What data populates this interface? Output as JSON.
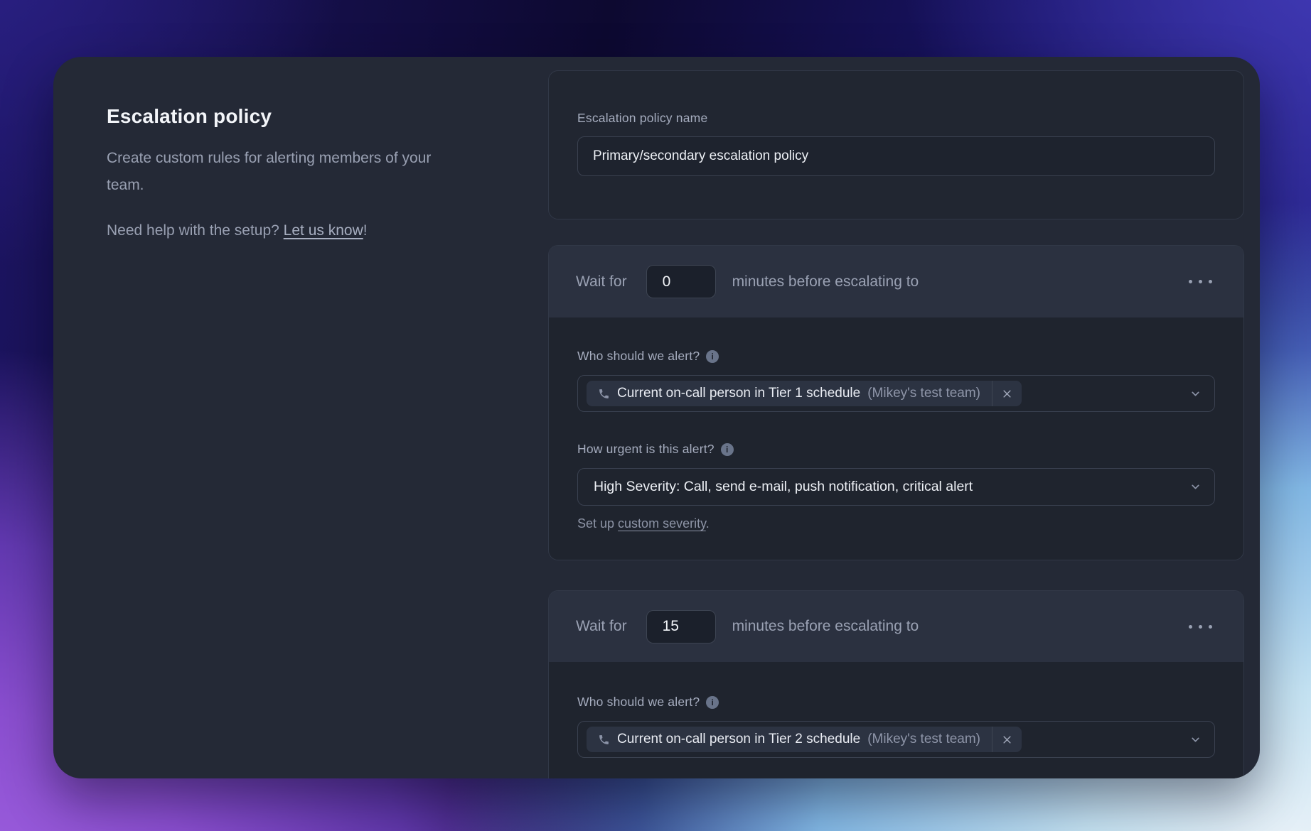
{
  "colors": {
    "card_bg": "#242936",
    "panel_body_bg": "#1f242e",
    "panel_header_bg": "#2b3140",
    "chip_bg": "#2c3342",
    "border": "#3a4150",
    "text_primary": "#f3f5f9",
    "text_muted": "#99a0b2",
    "gradient_top_left": "#2b2187",
    "gradient_top_center": "#0d0930",
    "gradient_top_right": "#433bb9",
    "gradient_bottom_left": "#a263e3",
    "gradient_bottom_right": "#ebf2f8"
  },
  "intro": {
    "title": "Escalation policy",
    "description": "Create custom rules for alerting members of your team.",
    "help_prefix": "Need help with the setup? ",
    "help_link": "Let us know",
    "help_suffix": "!"
  },
  "name_section": {
    "label": "Escalation policy name",
    "value": "Primary/secondary escalation policy"
  },
  "steps": [
    {
      "wait_prefix": "Wait for",
      "wait_minutes": "0",
      "wait_suffix": "minutes before escalating to",
      "alert_label": "Who should we alert?",
      "info_glyph": "i",
      "selection_name": "Current on-call person in Tier 1 schedule",
      "selection_team": "(Mikey's test team)",
      "urgency_label": "How urgent is this alert?",
      "urgency_value": "High Severity: Call, send e-mail, push notification, critical alert",
      "severity_prefix": "Set up ",
      "severity_link": "custom severity",
      "severity_suffix": "."
    },
    {
      "wait_prefix": "Wait for",
      "wait_minutes": "15",
      "wait_suffix": "minutes before escalating to",
      "alert_label": "Who should we alert?",
      "info_glyph": "i",
      "selection_name": "Current on-call person in Tier 2 schedule",
      "selection_team": "(Mikey's test team)"
    }
  ]
}
